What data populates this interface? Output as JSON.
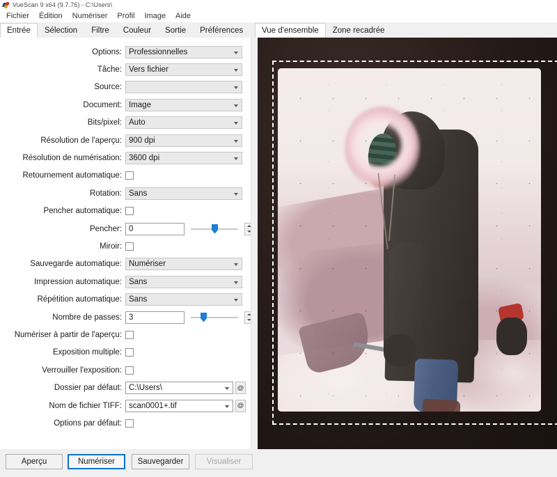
{
  "window": {
    "title": "VueScan 9 x64 (9.7.76) - C:\\Users\\",
    "icon": "vuescan-app-icon"
  },
  "menubar": {
    "items": [
      {
        "label": "Fichier"
      },
      {
        "label": "Édition"
      },
      {
        "label": "Numériser"
      },
      {
        "label": "Profil"
      },
      {
        "label": "Image"
      },
      {
        "label": "Aide"
      }
    ]
  },
  "left_tabs": {
    "active": "Entrée",
    "items": [
      {
        "label": "Entrée",
        "active": true
      },
      {
        "label": "Sélection",
        "active": false
      },
      {
        "label": "Filtre",
        "active": false
      },
      {
        "label": "Couleur",
        "active": false
      },
      {
        "label": "Sortie",
        "active": false
      },
      {
        "label": "Préférences",
        "active": false
      }
    ]
  },
  "form": {
    "options": {
      "label": "Options:",
      "value": "Professionnelles"
    },
    "tache": {
      "label": "Tâche:",
      "value": "Vers fichier"
    },
    "source": {
      "label": "Source:",
      "value": ""
    },
    "document": {
      "label": "Document:",
      "value": "Image"
    },
    "bits_pixel": {
      "label": "Bits/pixel:",
      "value": "Auto"
    },
    "preview_resolution": {
      "label": "Résolution de l'aperçu:",
      "value": "900 dpi"
    },
    "scan_resolution": {
      "label": "Résolution de numérisation:",
      "value": "3600 dpi"
    },
    "auto_flip": {
      "label": "Retournement automatique:",
      "checked": false
    },
    "rotation": {
      "label": "Rotation:",
      "value": "Sans"
    },
    "auto_skew": {
      "label": "Pencher automatique:",
      "checked": false
    },
    "skew": {
      "label": "Pencher:",
      "value": "0",
      "slider_percent": 50
    },
    "mirror": {
      "label": "Miroir:",
      "checked": false
    },
    "auto_save": {
      "label": "Sauvegarde automatique:",
      "value": "Numériser"
    },
    "auto_print": {
      "label": "Impression automatique:",
      "value": "Sans"
    },
    "auto_repeat": {
      "label": "Répétition automatique:",
      "value": "Sans"
    },
    "number_of_passes": {
      "label": "Nombre de passes:",
      "value": "3",
      "slider_percent": 23
    },
    "scan_from_preview": {
      "label": "Numériser à partir de l'aperçu:",
      "checked": false
    },
    "multi_exposure": {
      "label": "Exposition multiple:",
      "checked": false
    },
    "lock_exposure": {
      "label": "Verrouiller l'exposition:",
      "checked": false
    },
    "default_folder": {
      "label": "Dossier par défaut:",
      "value": "C:\\Users\\",
      "at_button": "@"
    },
    "tiff_file_name": {
      "label": "Nom de fichier TIFF:",
      "value": "scan0001+.tif",
      "at_button": "@"
    },
    "default_options": {
      "label": "Options par défaut:",
      "checked": false
    }
  },
  "buttons": {
    "preview": {
      "label": "Aperçu",
      "state": "normal"
    },
    "scan": {
      "label": "Numériser",
      "state": "focused"
    },
    "save": {
      "label": "Sauvegarder",
      "state": "normal"
    },
    "view": {
      "label": "Visualiser",
      "state": "disabled"
    }
  },
  "right_tabs": {
    "active": "Vue d'ensemble",
    "items": [
      {
        "label": "Vue d'ensemble",
        "active": true
      },
      {
        "label": "Zone recadrée",
        "active": false
      }
    ]
  },
  "preview": {
    "description": "Aperçu de diapositive numérisée : enfant en parka sombre à capuche bordée de fourrure rose, tenant une pelle dans la neige",
    "marquee": "selection-marquee"
  },
  "colors": {
    "accent": "#1d7fd4",
    "focus_border": "#0a72c7",
    "window_bg": "#f0f0f0",
    "panel_bg": "#ffffff"
  }
}
